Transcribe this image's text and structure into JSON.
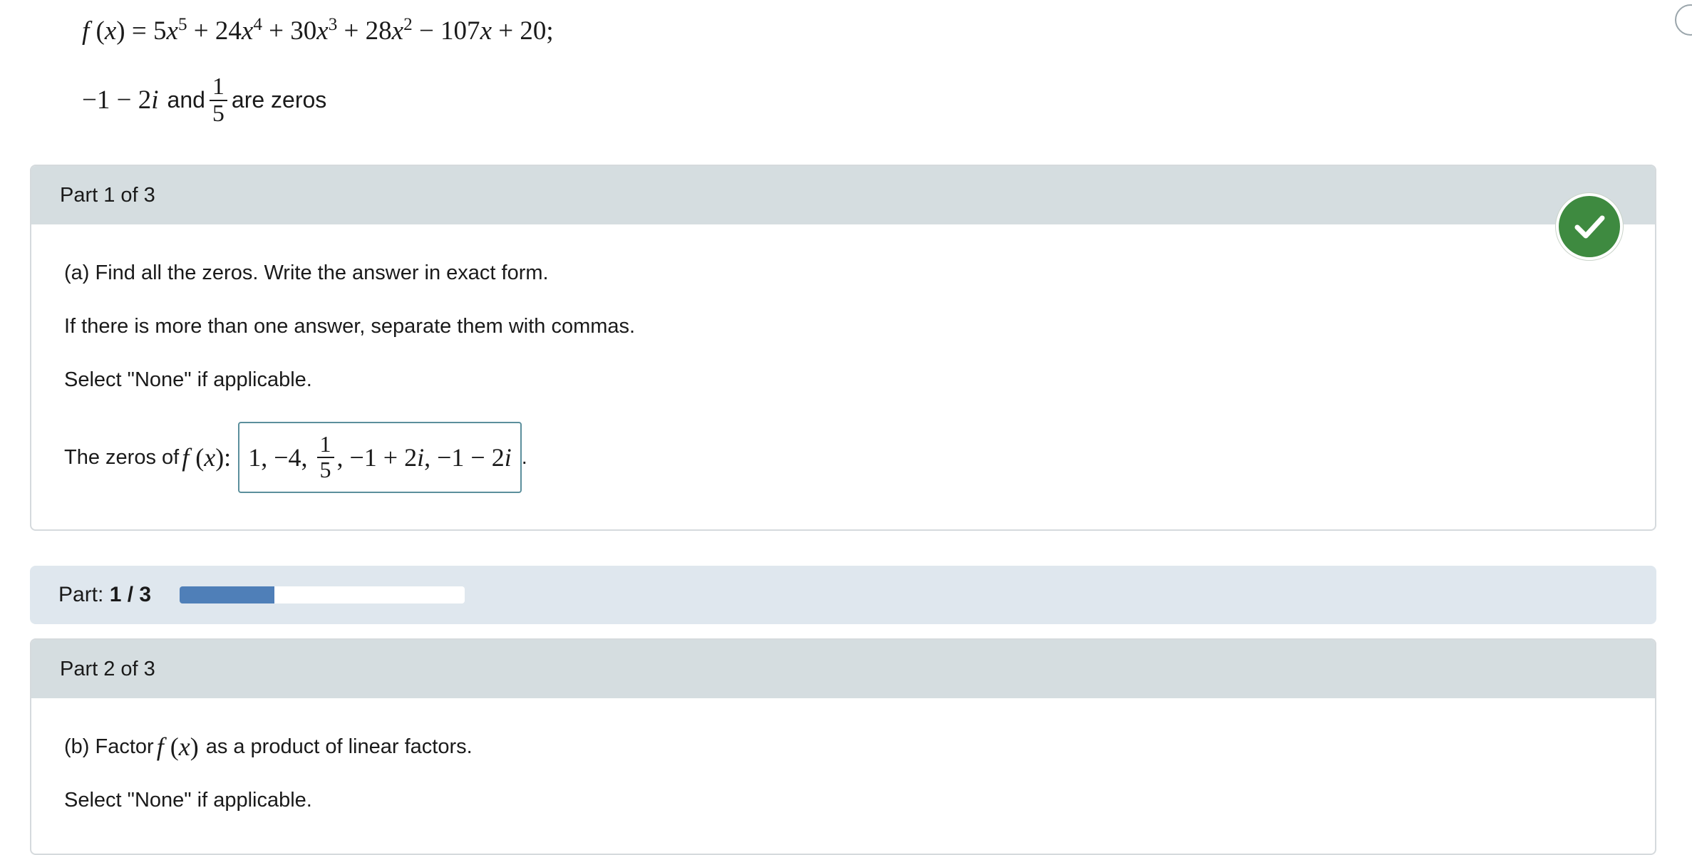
{
  "problem": {
    "given_zeros_suffix": "are zeros",
    "and_word": "and"
  },
  "part1": {
    "header": "Part 1 of 3",
    "instruction": "(a) Find all the zeros. Write the answer in exact form.",
    "separator_note": "If there is more than one answer, separate them with commas.",
    "none_note": "Select \"None\" if applicable.",
    "answer_prefix": "The zeros of",
    "answer_suffix": ".",
    "status": "correct"
  },
  "progress": {
    "label": "Part:",
    "value_text": "1 / 3",
    "fraction": 0.333
  },
  "part2": {
    "header": "Part 2 of 3",
    "instruction_prefix": "(b) Factor",
    "instruction_suffix": "as a product of linear factors.",
    "none_note": "Select \"None\" if applicable."
  },
  "colors": {
    "check_green": "#3e8a40",
    "progress_fill": "#4f7fb8",
    "header_gray": "#d5dde0"
  },
  "icons": {
    "correct": "check-circle-icon"
  }
}
